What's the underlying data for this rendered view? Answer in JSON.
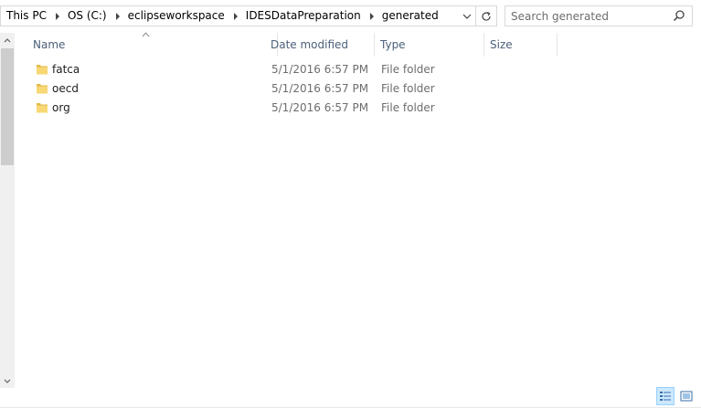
{
  "breadcrumb": [
    "This PC",
    "OS (C:)",
    "eclipseworkspace",
    "IDESDataPreparation",
    "generated"
  ],
  "search": {
    "placeholder": "Search generated"
  },
  "columns": {
    "name": "Name",
    "date": "Date modified",
    "type": "Type",
    "size": "Size"
  },
  "rows": [
    {
      "name": "fatca",
      "date": "5/1/2016 6:57 PM",
      "type": "File folder",
      "size": ""
    },
    {
      "name": "oecd",
      "date": "5/1/2016 6:57 PM",
      "type": "File folder",
      "size": ""
    },
    {
      "name": "org",
      "date": "5/1/2016 6:57 PM",
      "type": "File folder",
      "size": ""
    }
  ],
  "icons": {
    "address_dropdown": "chevron-down-icon",
    "refresh": "refresh-icon",
    "search": "search-icon",
    "folder": "folder-icon",
    "sort": "sort-ascending-icon",
    "view_details": "details-view-icon",
    "view_large": "large-icons-view-icon"
  },
  "colors": {
    "folder": "#f8d775",
    "selection": "#cce8ff",
    "header_text": "#4c607a"
  }
}
